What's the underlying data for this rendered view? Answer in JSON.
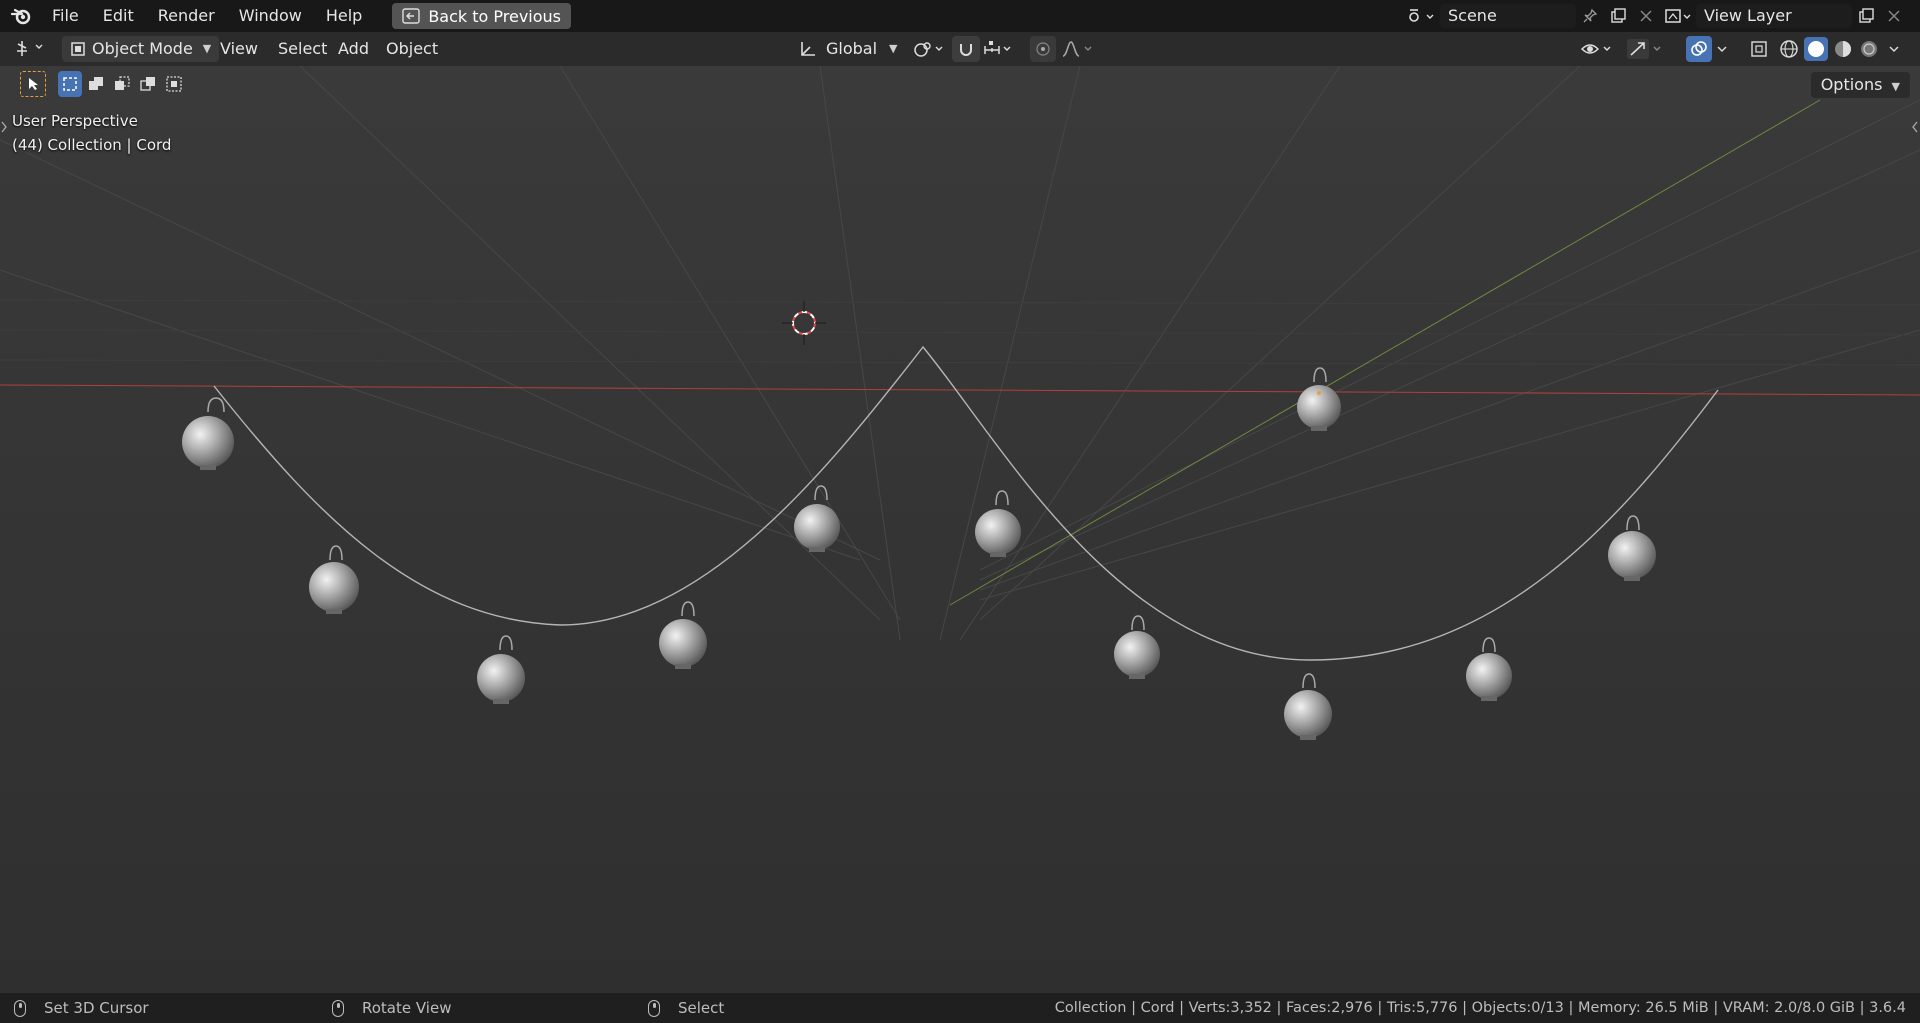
{
  "topbar": {
    "menus": [
      "File",
      "Edit",
      "Render",
      "Window",
      "Help"
    ],
    "back_button": "Back to Previous",
    "scene": "Scene",
    "view_layer": "View Layer"
  },
  "header": {
    "mode": "Object Mode",
    "menus": [
      "View",
      "Select",
      "Add",
      "Object"
    ],
    "orientation": "Global",
    "options": "Options"
  },
  "viewport": {
    "perspective": "User Perspective",
    "collection_info": "(44) Collection | Cord"
  },
  "statusbar": {
    "left_hint": "Set 3D Cursor",
    "middle_hint": "Rotate View",
    "right_hint": "Select",
    "stats": "Collection | Cord | Verts:3,352 | Faces:2,976 | Tris:5,776 | Objects:0/13 | Memory: 26.5 MiB | VRAM: 2.0/8.0 GiB | 3.6.4"
  },
  "colors": {
    "x_axis": "#b0403f",
    "y_axis": "#6e8a3c",
    "accent": "#4772b3",
    "ornament": "#b9b9b9"
  }
}
